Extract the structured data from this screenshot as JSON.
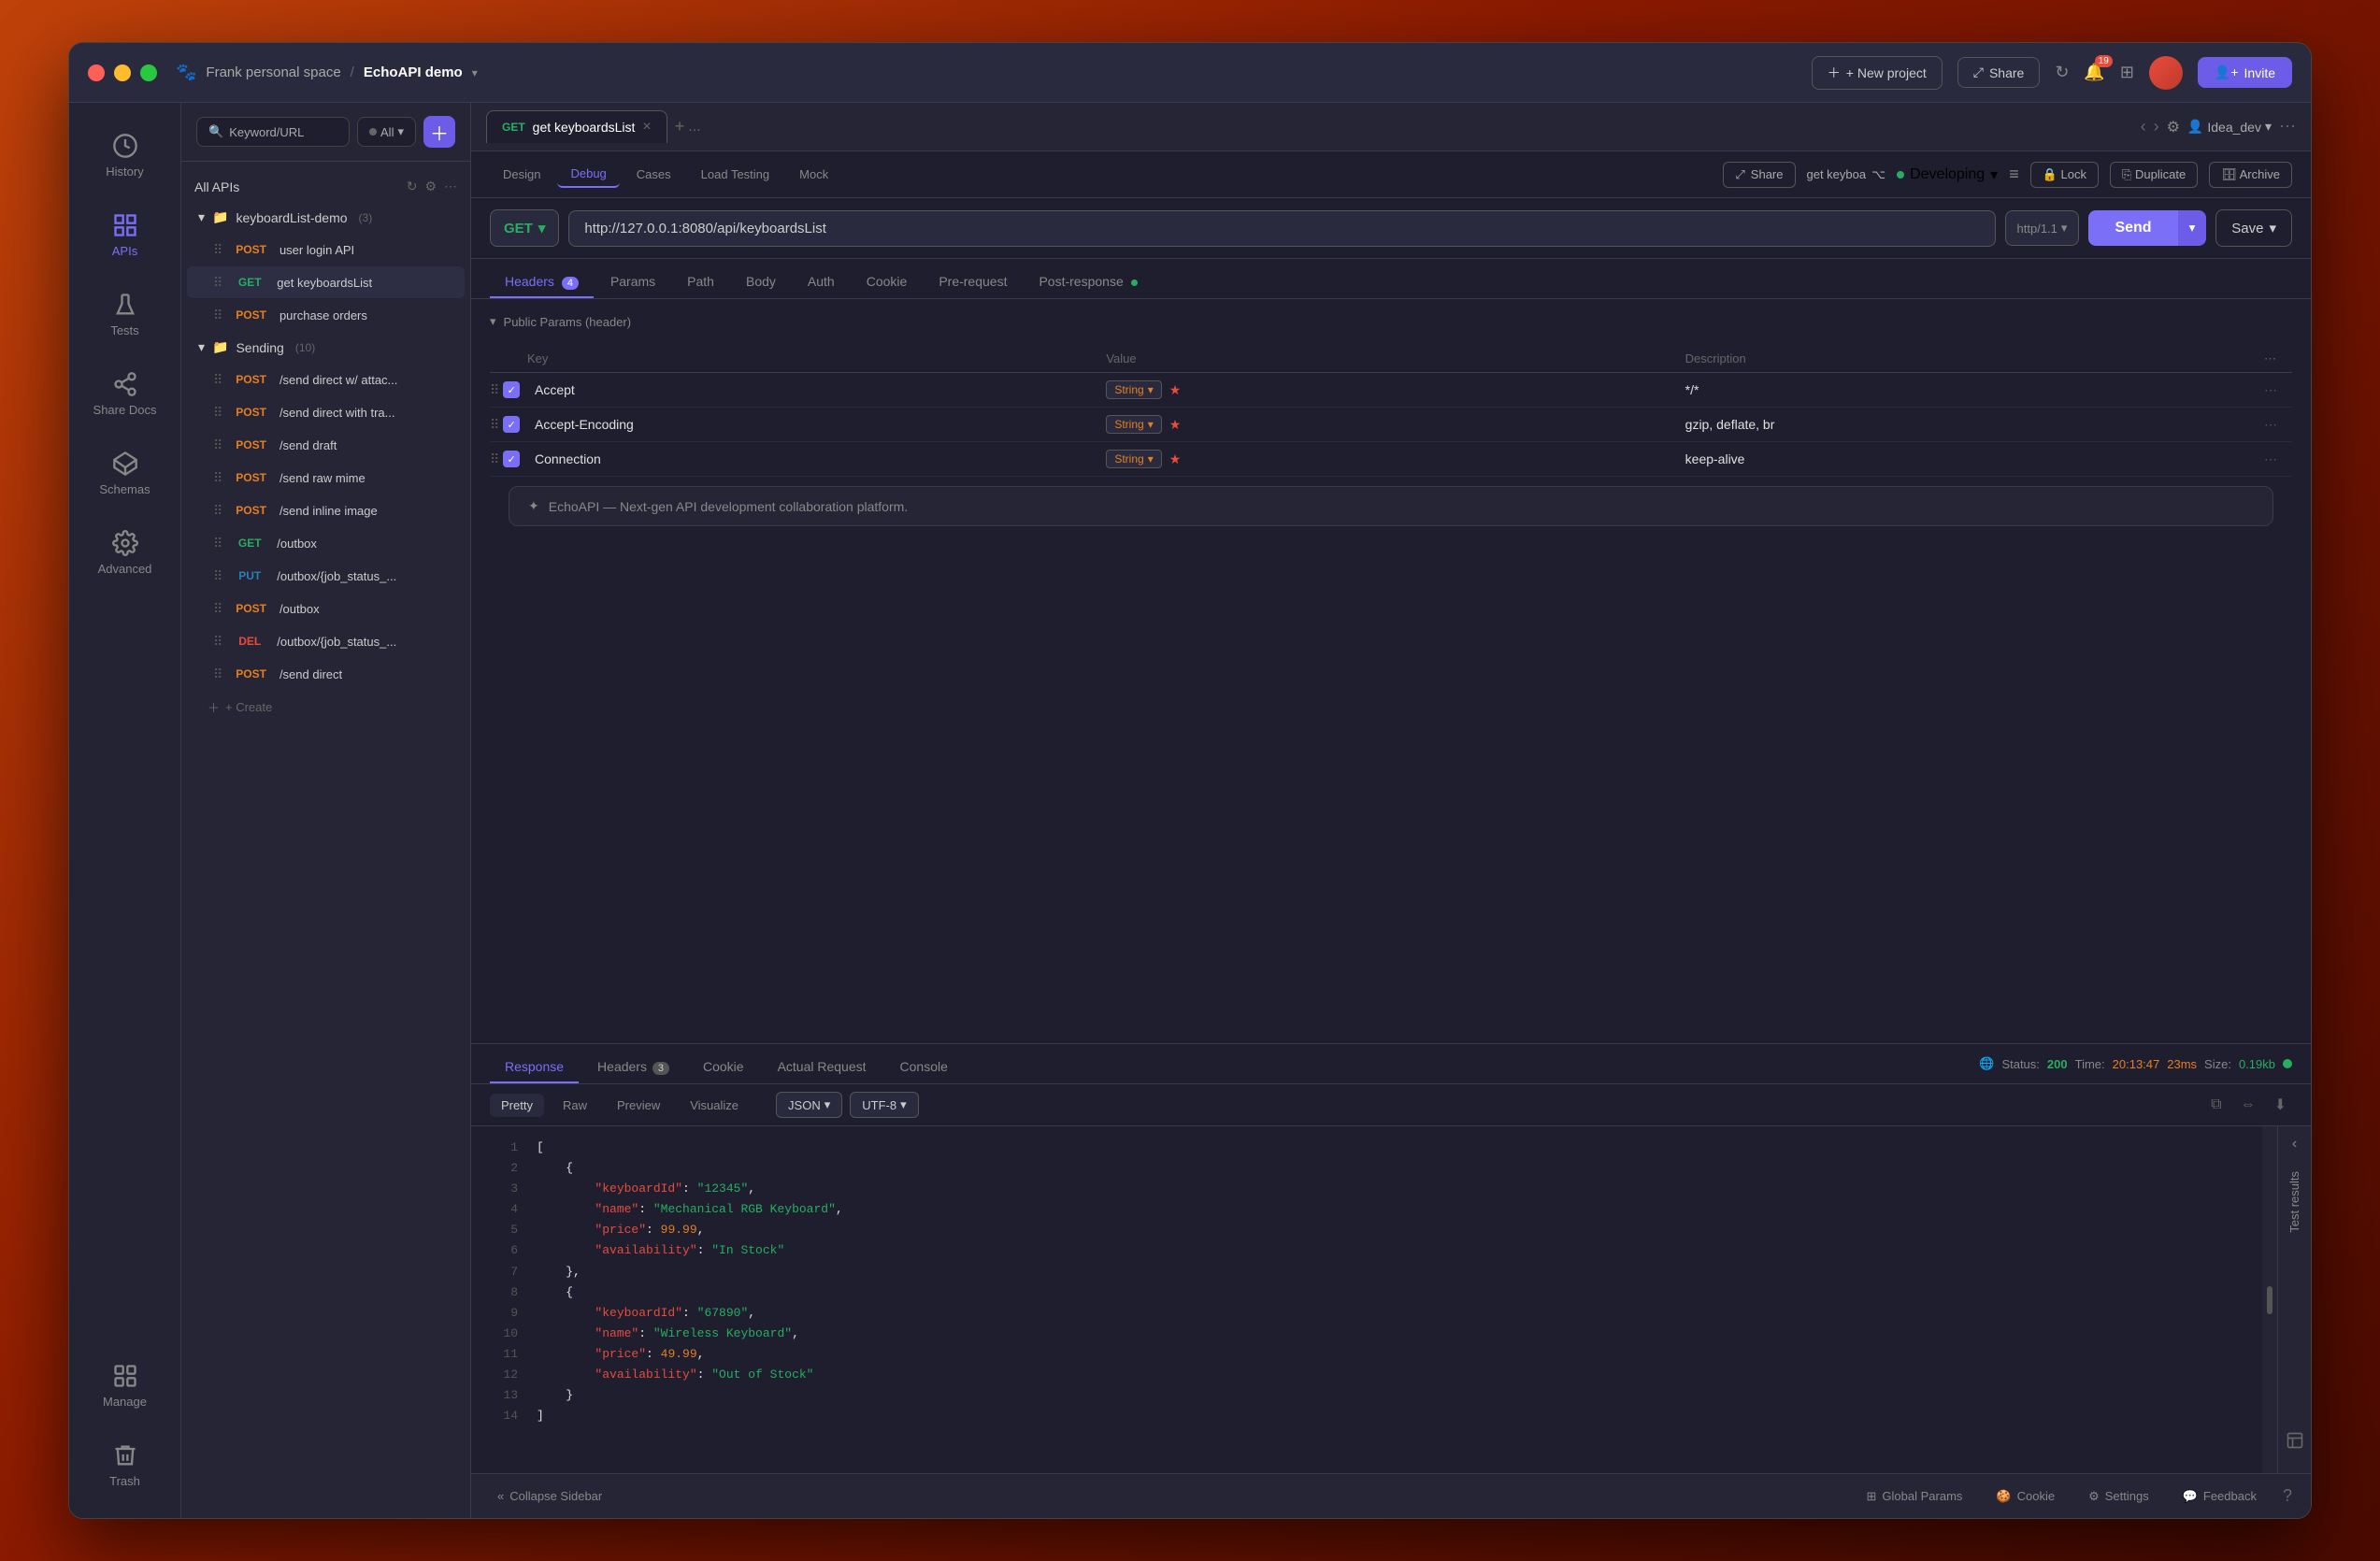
{
  "window": {
    "title": "EchoAPI demo",
    "workspace": "Frank personal space",
    "traffic_lights": [
      "red",
      "yellow",
      "green"
    ]
  },
  "titlebar": {
    "workspace_label": "Frank personal space",
    "separator": "/",
    "project_label": "EchoAPI demo",
    "new_project_label": "+ New project",
    "share_label": "Share",
    "notification_count": "19",
    "invite_label": "Invite"
  },
  "icon_sidebar": {
    "items": [
      {
        "id": "history",
        "label": "History",
        "icon": "clock"
      },
      {
        "id": "apis",
        "label": "APIs",
        "icon": "grid",
        "active": true
      },
      {
        "id": "tests",
        "label": "Tests",
        "icon": "flask"
      },
      {
        "id": "share-docs",
        "label": "Share Docs",
        "icon": "share"
      },
      {
        "id": "schemas",
        "label": "Schemas",
        "icon": "layers"
      },
      {
        "id": "advanced",
        "label": "Advanced",
        "icon": "settings"
      },
      {
        "id": "manage",
        "label": "Manage",
        "icon": "manage"
      },
      {
        "id": "trash",
        "label": "Trash",
        "icon": "trash"
      }
    ]
  },
  "api_sidebar": {
    "search_placeholder": "Keyword/URL",
    "filter_label": "All",
    "all_apis_label": "All APIs",
    "folder": {
      "name": "keyboardList-demo",
      "count": 3,
      "items": [
        {
          "method": "POST",
          "name": "user login API"
        },
        {
          "method": "GET",
          "name": "get keyboardsList",
          "active": true
        },
        {
          "method": "POST",
          "name": "purchase orders"
        }
      ]
    },
    "sending_folder": {
      "name": "Sending",
      "count": 10,
      "items": [
        {
          "method": "POST",
          "name": "/send direct w/ attac..."
        },
        {
          "method": "POST",
          "name": "/send direct with tra..."
        },
        {
          "method": "POST",
          "name": "/send draft"
        },
        {
          "method": "POST",
          "name": "/send raw mime"
        },
        {
          "method": "POST",
          "name": "/send inline image"
        },
        {
          "method": "GET",
          "name": "/outbox"
        },
        {
          "method": "PUT",
          "name": "/outbox/{job_status_..."
        },
        {
          "method": "POST",
          "name": "/outbox"
        },
        {
          "method": "DEL",
          "name": "/outbox/{job_status_..."
        },
        {
          "method": "POST",
          "name": "/send direct"
        }
      ]
    },
    "create_label": "+ Create"
  },
  "tab": {
    "method": "GET",
    "name": "get keyboardsList",
    "plus_icon": "+",
    "more_icon": "..."
  },
  "request_nav": {
    "tabs": [
      "Design",
      "Debug",
      "Cases",
      "Load Testing",
      "Mock"
    ],
    "active_tab": "Debug",
    "share_label": "Share",
    "branch_label": "get keyboa",
    "developing_label": "Developing",
    "lock_label": "Lock",
    "duplicate_label": "Duplicate",
    "archive_label": "Archive"
  },
  "url_bar": {
    "method": "GET",
    "url": "http://127.0.0.1:8080/api/keyboardsList",
    "protocol": "http/1.1",
    "send_label": "Send",
    "save_label": "Save"
  },
  "params_tabs": {
    "tabs": [
      {
        "label": "Headers",
        "count": 4,
        "active": true
      },
      {
        "label": "Params"
      },
      {
        "label": "Path"
      },
      {
        "label": "Body"
      },
      {
        "label": "Auth"
      },
      {
        "label": "Cookie"
      },
      {
        "label": "Pre-request"
      },
      {
        "label": "Post-response",
        "dot": true
      }
    ]
  },
  "headers_table": {
    "columns": [
      "",
      "Key",
      "Value",
      "Description",
      ""
    ],
    "public_params_label": "Public Params (header)",
    "rows": [
      {
        "key": "Accept",
        "type": "String",
        "required": true,
        "value": "*/*",
        "desc": ""
      },
      {
        "key": "Accept-Encoding",
        "type": "String",
        "required": true,
        "value": "gzip, deflate, br",
        "desc": ""
      },
      {
        "key": "Connection",
        "type": "String",
        "required": true,
        "value": "keep-alive",
        "desc": ""
      }
    ]
  },
  "ai_banner": {
    "text": "EchoAPI — Next-gen API development collaboration platform."
  },
  "response": {
    "tabs": [
      "Response",
      "Headers",
      "Cookie",
      "Actual Request",
      "Console"
    ],
    "active_tab": "Response",
    "headers_count": 3,
    "actual_request_dot": true,
    "status_label": "Status:",
    "status_code": "200",
    "time_label": "Time:",
    "time_value": "20:13:47",
    "time_ms": "23ms",
    "size_label": "Size:",
    "size_value": "0.19kb",
    "format_tabs": [
      "Pretty",
      "Raw",
      "Preview",
      "Visualize"
    ],
    "active_format": "Pretty",
    "format_selector": "JSON",
    "encoding_selector": "UTF-8",
    "code_lines": [
      {
        "num": 1,
        "content": "["
      },
      {
        "num": 2,
        "content": "    {"
      },
      {
        "num": 3,
        "content": "        \"keyboardId\": \"12345\","
      },
      {
        "num": 4,
        "content": "        \"name\": \"Mechanical RGB Keyboard\","
      },
      {
        "num": 5,
        "content": "        \"price\": 99.99,"
      },
      {
        "num": 6,
        "content": "        \"availability\": \"In Stock\""
      },
      {
        "num": 7,
        "content": "    },"
      },
      {
        "num": 8,
        "content": "    {"
      },
      {
        "num": 9,
        "content": "        \"keyboardId\": \"67890\","
      },
      {
        "num": 10,
        "content": "        \"name\": \"Wireless Keyboard\","
      },
      {
        "num": 11,
        "content": "        \"price\": 49.99,"
      },
      {
        "num": 12,
        "content": "        \"availability\": \"Out of Stock\""
      },
      {
        "num": 13,
        "content": "    }"
      },
      {
        "num": 14,
        "content": "]"
      }
    ]
  },
  "bottom_bar": {
    "collapse_label": "Collapse Sidebar",
    "global_params_label": "Global Params",
    "cookie_label": "Cookie",
    "settings_label": "Settings",
    "feedback_label": "Feedback"
  },
  "idea_dev_label": "Idea_dev",
  "env_selector_placeholder": "Idea_dev"
}
